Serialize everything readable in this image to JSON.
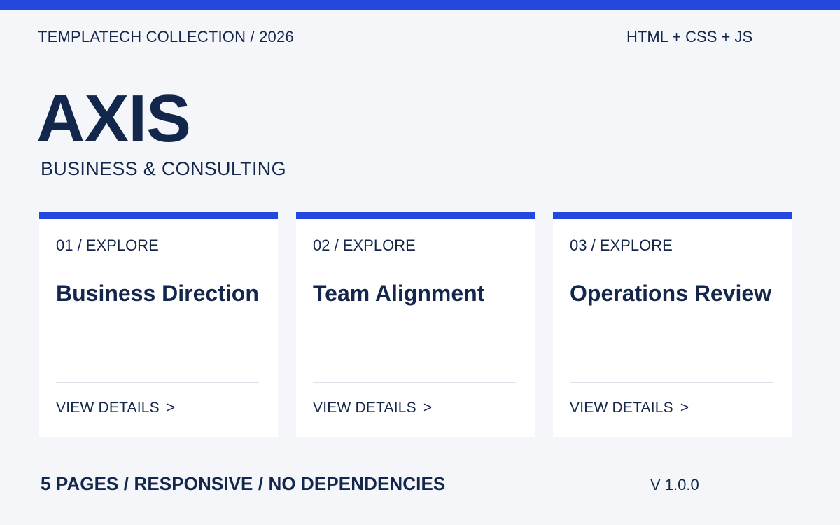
{
  "header": {
    "collection": "TEMPLATECH COLLECTION / 2026",
    "tech": "HTML + CSS + JS"
  },
  "hero": {
    "title": "AXIS",
    "subtitle": "BUSINESS & CONSULTING"
  },
  "cards": [
    {
      "number": "01 / EXPLORE",
      "title": "Business Direction",
      "link": "VIEW DETAILS",
      "arrow": ">"
    },
    {
      "number": "02 / EXPLORE",
      "title": "Team Alignment",
      "link": "VIEW DETAILS",
      "arrow": ">"
    },
    {
      "number": "03 / EXPLORE",
      "title": "Operations Review",
      "link": "VIEW DETAILS",
      "arrow": ">"
    }
  ],
  "footer": {
    "features": "5 PAGES / RESPONSIVE / NO DEPENDENCIES",
    "version": "V 1.0.0"
  },
  "colors": {
    "accent": "#2447de",
    "text": "#13264b",
    "background": "#f4f6fa",
    "card": "#ffffff"
  }
}
